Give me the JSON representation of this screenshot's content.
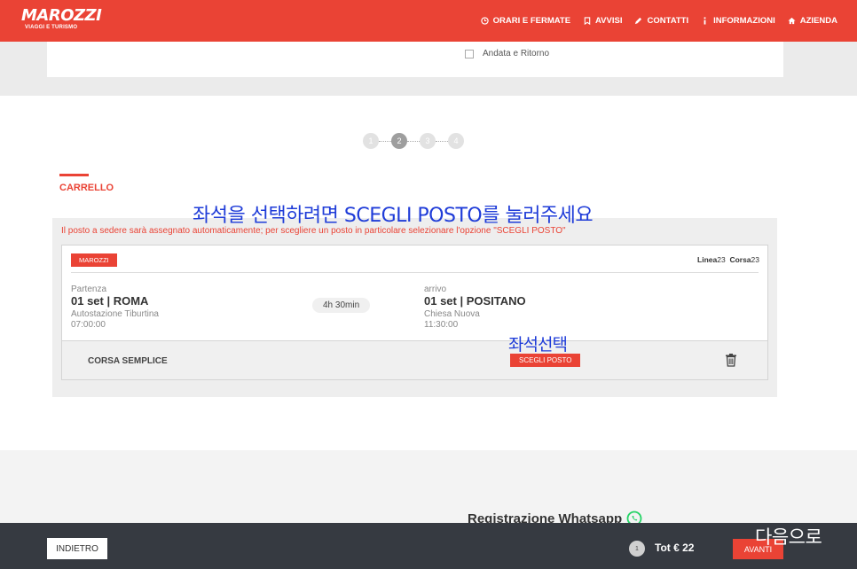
{
  "header": {
    "logo_main": "MAROZZI",
    "logo_sub": "VIAGGI E TURISMO",
    "nav": [
      {
        "label": "ORARI E FERMATE",
        "icon": "clock-icon"
      },
      {
        "label": "AVVISI",
        "icon": "bookmark-icon"
      },
      {
        "label": "CONTATTI",
        "icon": "pencil-icon"
      },
      {
        "label": "INFORMAZIONI",
        "icon": "info-icon"
      },
      {
        "label": "AZIENDA",
        "icon": "home-icon"
      }
    ]
  },
  "search": {
    "round_trip_label": "Andata e Ritorno",
    "round_trip_checked": false
  },
  "steps": {
    "items": [
      "1",
      "2",
      "3",
      "4"
    ],
    "active": "2"
  },
  "cart": {
    "title": "CARRELLO",
    "message": "Il posto a sedere sarà assegnato automaticamente; per scegliere un posto in particolare selezionare l'opzione \"SCEGLI POSTO\"",
    "trip": {
      "company": "MAROZZI",
      "linea_label": "Linea",
      "linea_value": "23",
      "corsa_label": "Corsa",
      "corsa_value": "23",
      "departure": {
        "label": "Partenza",
        "city": "01 set | ROMA",
        "station": "Autostazione Tiburtina",
        "time": "07:00:00"
      },
      "duration": "4h 30min",
      "arrival": {
        "label": "arrivo",
        "city": "01 set | POSITANO",
        "station": "Chiesa Nuova",
        "time": "11:30:00"
      },
      "fare_type": "CORSA SEMPLICE",
      "choose_seat_label": "SCEGLI POSTO"
    }
  },
  "annotations": {
    "top": "좌석을 선택하려면 SCEGLI POSTO를 눌러주세요",
    "seat": "좌석선택",
    "next": "다음으로"
  },
  "whatsapp": {
    "title": "Registrazione Whatsapp"
  },
  "footer": {
    "back_label": "INDIETRO",
    "cart_count": "1",
    "total": "Tot € 22",
    "next_label": "AVANTI"
  },
  "colors": {
    "brand": "#ea4335",
    "footer_bg": "#363a41",
    "annotation": "#1f3cd8",
    "whatsapp": "#25d366"
  }
}
